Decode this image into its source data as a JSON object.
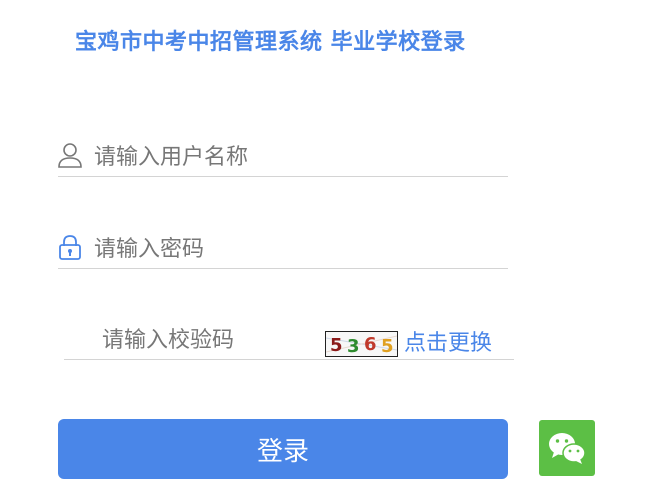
{
  "page": {
    "title": "宝鸡市中考中招管理系统 毕业学校登录"
  },
  "form": {
    "username_placeholder": "请输入用户名称",
    "username_value": "",
    "password_placeholder": "请输入密码",
    "password_value": "",
    "captcha_placeholder": "请输入校验码",
    "captcha_value": "",
    "captcha_digits": [
      "5",
      "3",
      "6",
      "5"
    ],
    "refresh_label": "点击更换",
    "login_label": "登录"
  },
  "colors": {
    "accent": "#4a86e8",
    "wechat": "#5cbf45",
    "captcha_digit_colors": [
      "#8b1a1a",
      "#2e8b2e",
      "#c0392b",
      "#e0a020"
    ]
  },
  "icons": {
    "username": "user-icon",
    "password": "lock-icon",
    "social": "wechat-icon"
  }
}
